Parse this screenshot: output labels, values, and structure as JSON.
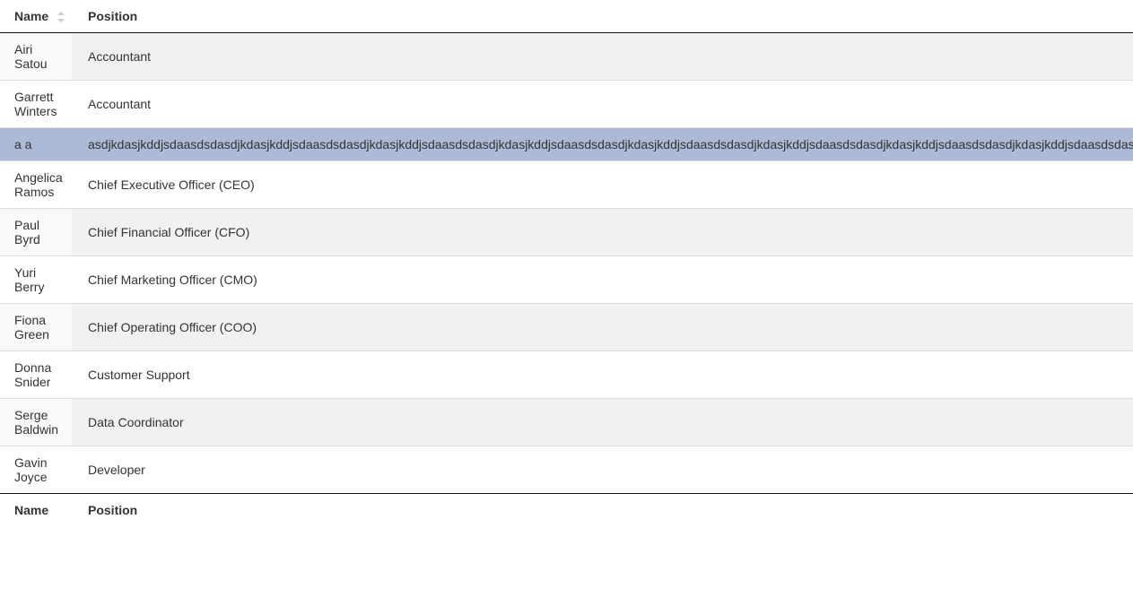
{
  "table": {
    "headers": {
      "name": "Name",
      "position": "Position"
    },
    "footers": {
      "name": "Name",
      "position": "Position"
    },
    "rows": [
      {
        "name": "Airi Satou",
        "position": "Accountant",
        "stripe": "odd",
        "selected": false
      },
      {
        "name": "Garrett Winters",
        "position": "Accountant",
        "stripe": "even",
        "selected": false
      },
      {
        "name": "a a",
        "position": "asdjkdasjkddjsdaasdsdasdjkdasjkddjsdaasdsdasdjkdasjkddjsdaasdsdasdjkdasjkddjsdaasdsdasdjkdasjkddjsdaasdsdasdjkdasjkddjsdaasdsdasdjkdasjkddjsdaasdsdasdjkdasjkddjsdaasdsdasdjkdasjkddjsdaasdsdasdjkdasjkddjsdaasdsda",
        "stripe": "odd",
        "selected": true
      },
      {
        "name": "Angelica Ramos",
        "position": "Chief Executive Officer (CEO)",
        "stripe": "even",
        "selected": false
      },
      {
        "name": "Paul Byrd",
        "position": "Chief Financial Officer (CFO)",
        "stripe": "odd",
        "selected": false
      },
      {
        "name": "Yuri Berry",
        "position": "Chief Marketing Officer (CMO)",
        "stripe": "even",
        "selected": false
      },
      {
        "name": "Fiona Green",
        "position": "Chief Operating Officer (COO)",
        "stripe": "odd",
        "selected": false
      },
      {
        "name": "Donna Snider",
        "position": "Customer Support",
        "stripe": "even",
        "selected": false
      },
      {
        "name": "Serge Baldwin",
        "position": "Data Coordinator",
        "stripe": "odd",
        "selected": false
      },
      {
        "name": "Gavin Joyce",
        "position": "Developer",
        "stripe": "even",
        "selected": false
      }
    ]
  }
}
